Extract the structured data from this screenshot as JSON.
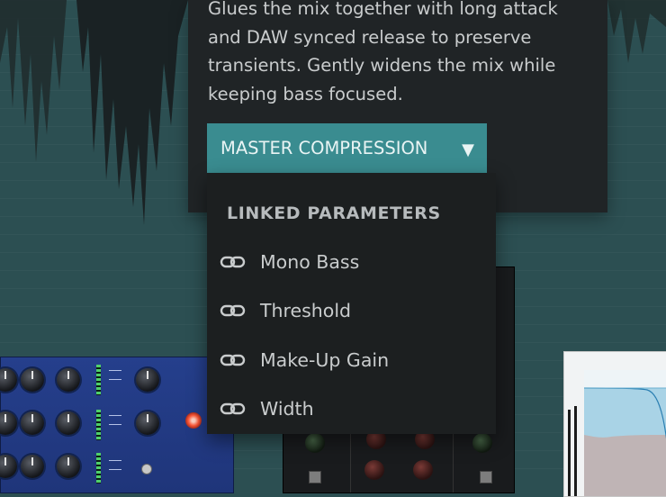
{
  "popover": {
    "description": "Glues the mix together with long attack and DAW synced release to preserve transients. Gently widens the mix while keeping bass focused.",
    "dropdown_label": "MASTER COMPRESSION",
    "dropdown_caret": "▼"
  },
  "menu": {
    "heading": "LINKED PARAMETERS",
    "items": [
      {
        "label": "Mono Bass",
        "icon": "link-icon"
      },
      {
        "label": "Threshold",
        "icon": "link-icon"
      },
      {
        "label": "Make-Up Gain",
        "icon": "link-icon"
      },
      {
        "label": "Width",
        "icon": "link-icon"
      }
    ]
  },
  "colors": {
    "background": "#2c4f52",
    "accent": "#3a8c90",
    "popover": "#202426",
    "menu": "#1c1f20",
    "text": "#c9cccd"
  }
}
